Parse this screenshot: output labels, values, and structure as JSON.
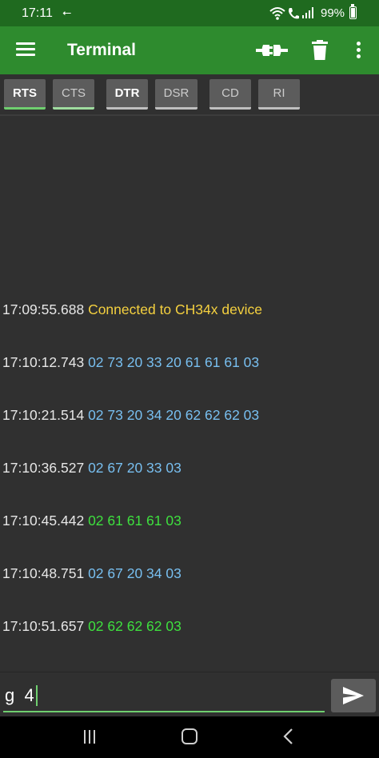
{
  "status_bar": {
    "time": "17:11",
    "usb_glyph": "⭠",
    "battery_percent": "99%",
    "icons": [
      "usb-debug-icon",
      "wifi-icon",
      "wifi-call-icon",
      "signal-icon",
      "battery-icon"
    ]
  },
  "app_bar": {
    "title": "Terminal",
    "icons": [
      "menu-icon",
      "connect-icon",
      "delete-icon",
      "more-options-icon"
    ]
  },
  "control_lines": [
    {
      "label": "RTS",
      "active": true
    },
    {
      "label": "CTS",
      "active": false
    },
    {
      "label": "DTR",
      "active": true
    },
    {
      "label": "DSR",
      "active": false
    },
    {
      "label": "CD",
      "active": false
    },
    {
      "label": "RI",
      "active": false
    }
  ],
  "log": [
    {
      "time": "17:09:55.688",
      "text": "Connected to CH34x device",
      "kind": "status"
    },
    {
      "time": "17:10:12.743",
      "text": "02 73 20 33 20 61 61 61 03",
      "kind": "sent"
    },
    {
      "time": "17:10:21.514",
      "text": "02 73 20 34 20 62 62 62 03",
      "kind": "sent"
    },
    {
      "time": "17:10:36.527",
      "text": "02 67 20 33 03",
      "kind": "sent"
    },
    {
      "time": "17:10:45.442",
      "text": "02 61 61 61 03",
      "kind": "received"
    },
    {
      "time": "17:10:48.751",
      "text": "02 67 20 34 03",
      "kind": "sent"
    },
    {
      "time": "17:10:51.657",
      "text": "02 62 62 62 03",
      "kind": "received"
    }
  ],
  "colors": {
    "status": "#f4d03f",
    "sent": "#78bff0",
    "received": "#3ee03e",
    "app_bar": "#2e8b2e",
    "accent": "#6fcf6f"
  },
  "input": {
    "value": "g  4"
  },
  "send_button": {
    "icon": "send-icon"
  },
  "nav_bar": {
    "icons": [
      "recent-apps-icon",
      "home-icon",
      "back-icon"
    ]
  }
}
